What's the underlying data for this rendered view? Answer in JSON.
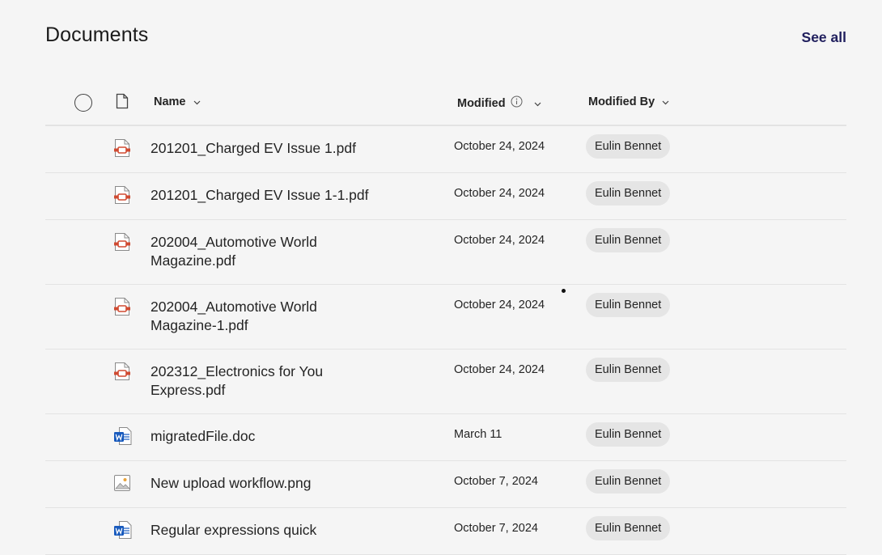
{
  "section": {
    "title": "Documents",
    "see_all": "See all"
  },
  "columns": {
    "name": "Name",
    "modified": "Modified",
    "modified_by": "Modified By"
  },
  "icons": {
    "select_all": "radio-circle-icon",
    "file_type": "file-icon",
    "sort": "chevron-down-icon",
    "info": "info-icon"
  },
  "rows": [
    {
      "type": "pdf",
      "name": "201201_Charged EV Issue 1.pdf",
      "modified": "October 24, 2024",
      "modified_by": "Eulin Bennet"
    },
    {
      "type": "pdf",
      "name": "201201_Charged EV Issue 1-1.pdf",
      "modified": "October 24, 2024",
      "modified_by": "Eulin Bennet"
    },
    {
      "type": "pdf",
      "name": "202004_Automotive World Magazine.pdf",
      "modified": "October 24, 2024",
      "modified_by": "Eulin Bennet"
    },
    {
      "type": "pdf",
      "name": "202004_Automotive World Magazine-1.pdf",
      "modified": "October 24, 2024",
      "modified_by": "Eulin Bennet"
    },
    {
      "type": "pdf",
      "name": "202312_Electronics for You Express.pdf",
      "modified": "October 24, 2024",
      "modified_by": "Eulin Bennet"
    },
    {
      "type": "word",
      "name": "migratedFile.doc",
      "modified": "March 11",
      "modified_by": "Eulin Bennet"
    },
    {
      "type": "image",
      "name": "New upload workflow.png",
      "modified": "October 7, 2024",
      "modified_by": "Eulin Bennet"
    },
    {
      "type": "word",
      "name": "Regular expressions quick",
      "modified": "October 7, 2024",
      "modified_by": "Eulin Bennet"
    }
  ],
  "colors": {
    "pdf": "#d04a31",
    "word": "#185abd",
    "link": "#21205e"
  }
}
